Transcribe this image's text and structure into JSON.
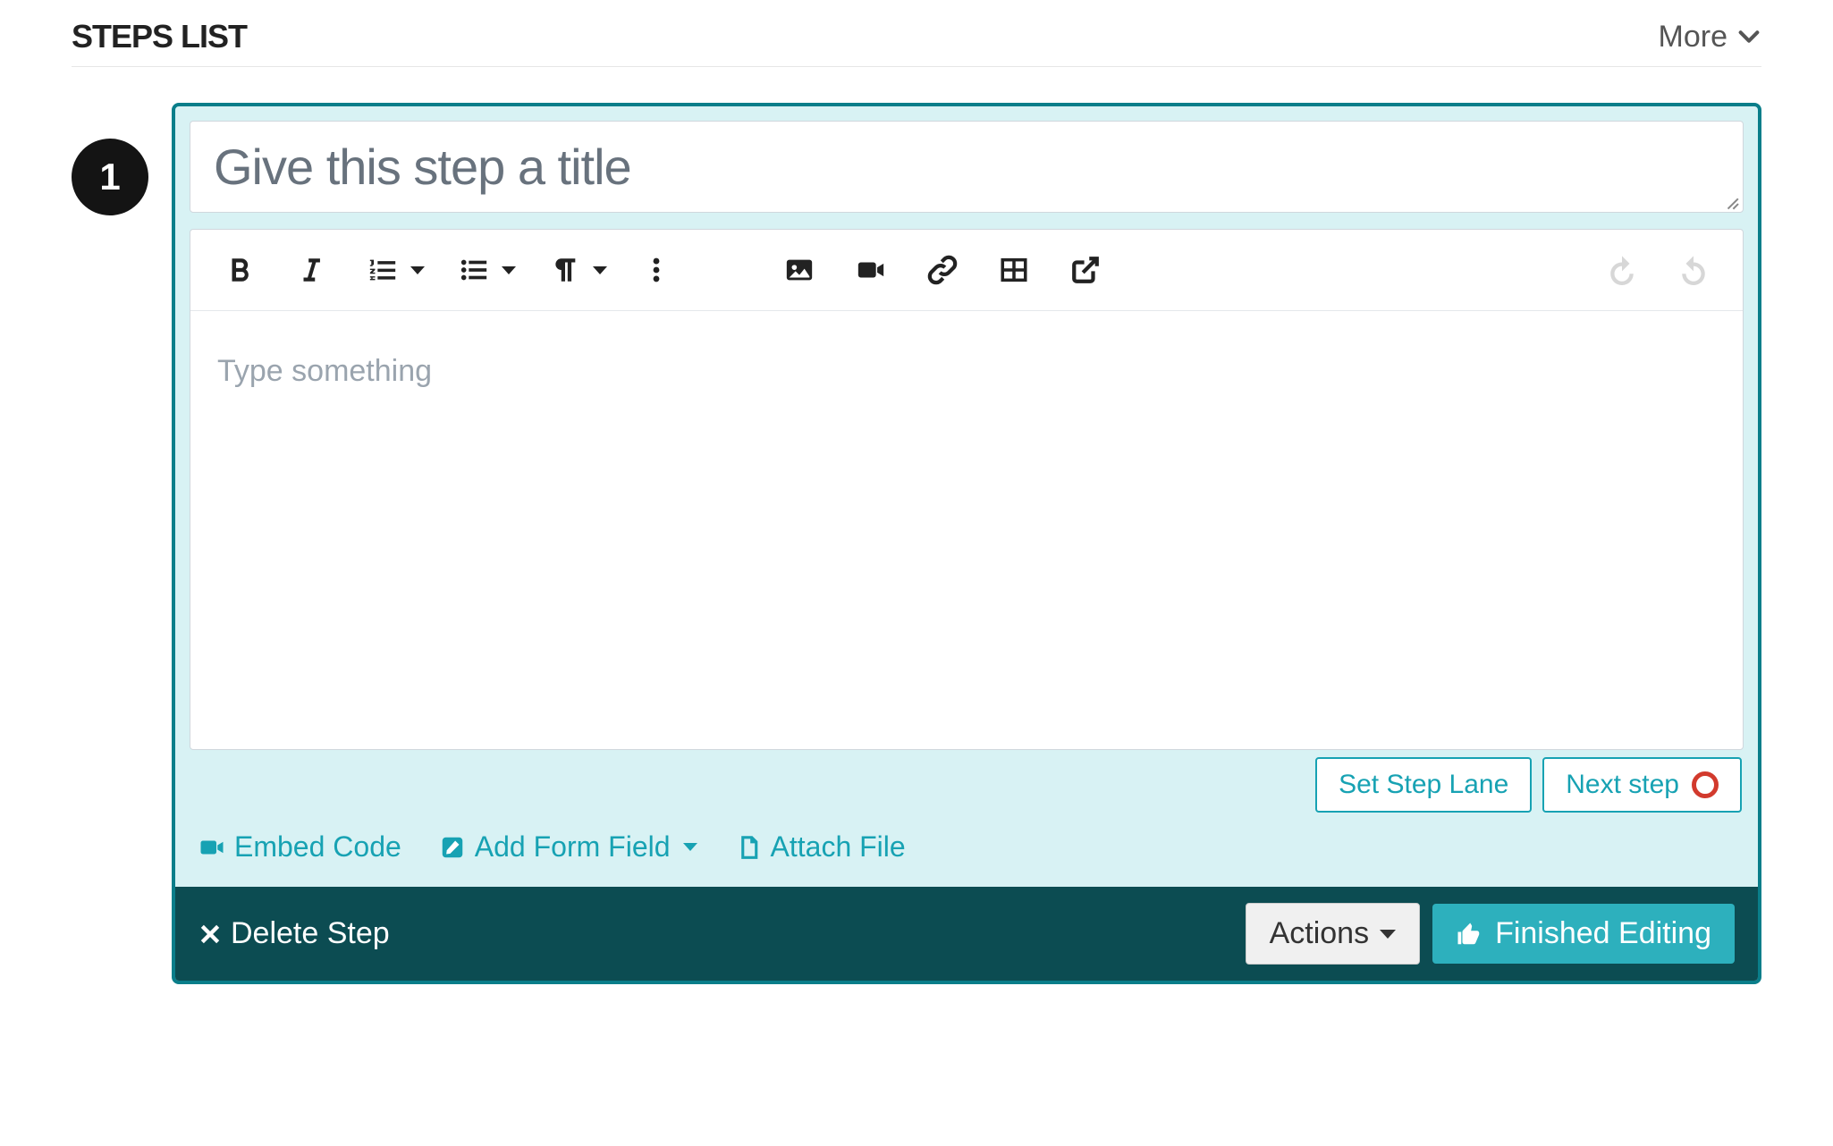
{
  "header": {
    "title": "STEPS LIST",
    "more_label": "More"
  },
  "step": {
    "number": "1",
    "title_placeholder": "Give this step a title",
    "content_placeholder": "Type something"
  },
  "lane_row": {
    "set_lane": "Set Step Lane",
    "next_step": "Next step"
  },
  "action_links": {
    "embed": "Embed Code",
    "add_field": "Add Form Field",
    "attach": "Attach File"
  },
  "footer": {
    "delete": "Delete Step",
    "actions": "Actions",
    "finished": "Finished Editing"
  },
  "toolbar_icons": {
    "bold": "bold-icon",
    "italic": "italic-icon",
    "ol": "ordered-list-icon",
    "ul": "unordered-list-icon",
    "para": "paragraph-icon",
    "more": "more-icon",
    "image": "image-icon",
    "video": "video-icon",
    "link": "link-icon",
    "table": "table-icon",
    "external": "external-link-icon",
    "undo": "undo-icon",
    "redo": "redo-icon"
  }
}
